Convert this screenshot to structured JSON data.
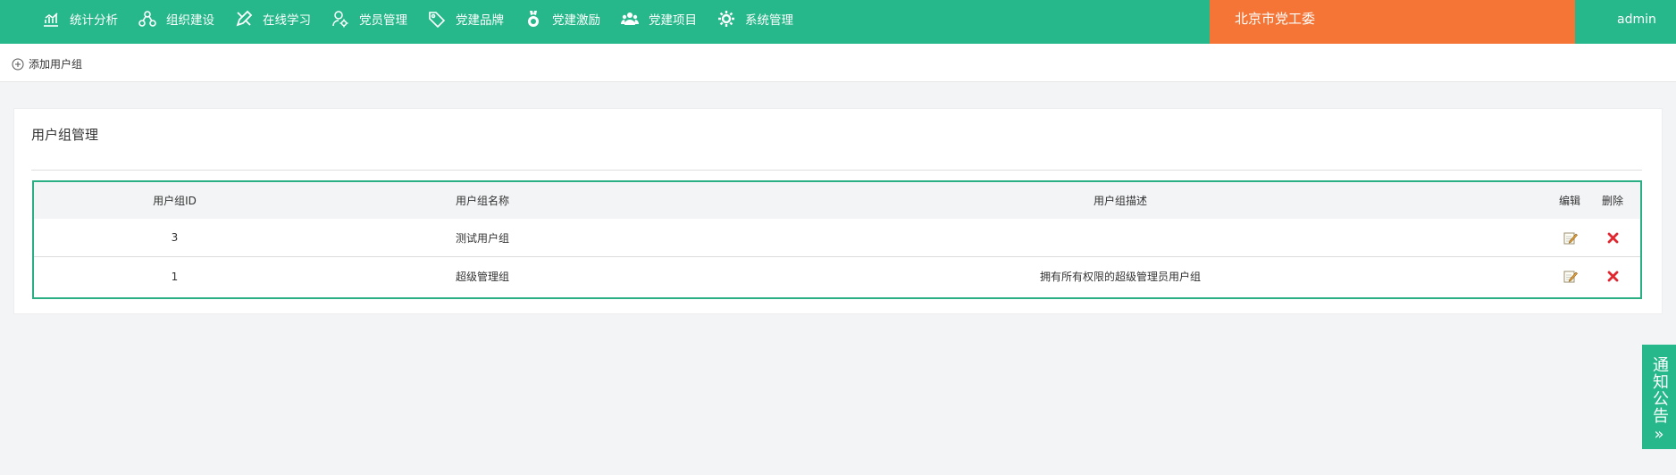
{
  "nav": [
    {
      "label": "统计分析",
      "icon": "chart-icon"
    },
    {
      "label": "组织建设",
      "icon": "org-tree-icon"
    },
    {
      "label": "在线学习",
      "icon": "pencil-icon"
    },
    {
      "label": "党员管理",
      "icon": "member-gear-icon"
    },
    {
      "label": "党建品牌",
      "icon": "tag-icon"
    },
    {
      "label": "党建激励",
      "icon": "medal-icon"
    },
    {
      "label": "党建项目",
      "icon": "group-icon"
    },
    {
      "label": "系统管理",
      "icon": "gear-icon"
    }
  ],
  "org_name": "北京市党工委",
  "user": "admin",
  "toolbar": {
    "add_label": "添加用户组"
  },
  "panel": {
    "title": "用户组管理"
  },
  "table": {
    "headers": {
      "id": "用户组ID",
      "name": "用户组名称",
      "desc": "用户组描述",
      "edit": "编辑",
      "del": "删除"
    },
    "rows": [
      {
        "id": "3",
        "name": "测试用户组",
        "desc": ""
      },
      {
        "id": "1",
        "name": "超级管理组",
        "desc": "拥有所有权限的超级管理员用户组"
      }
    ]
  },
  "notice": {
    "label": "通知公告",
    "chevron": "»"
  },
  "colors": {
    "brand_green": "#26b88a",
    "org_orange": "#f47535",
    "delete_red": "#e0262f"
  }
}
